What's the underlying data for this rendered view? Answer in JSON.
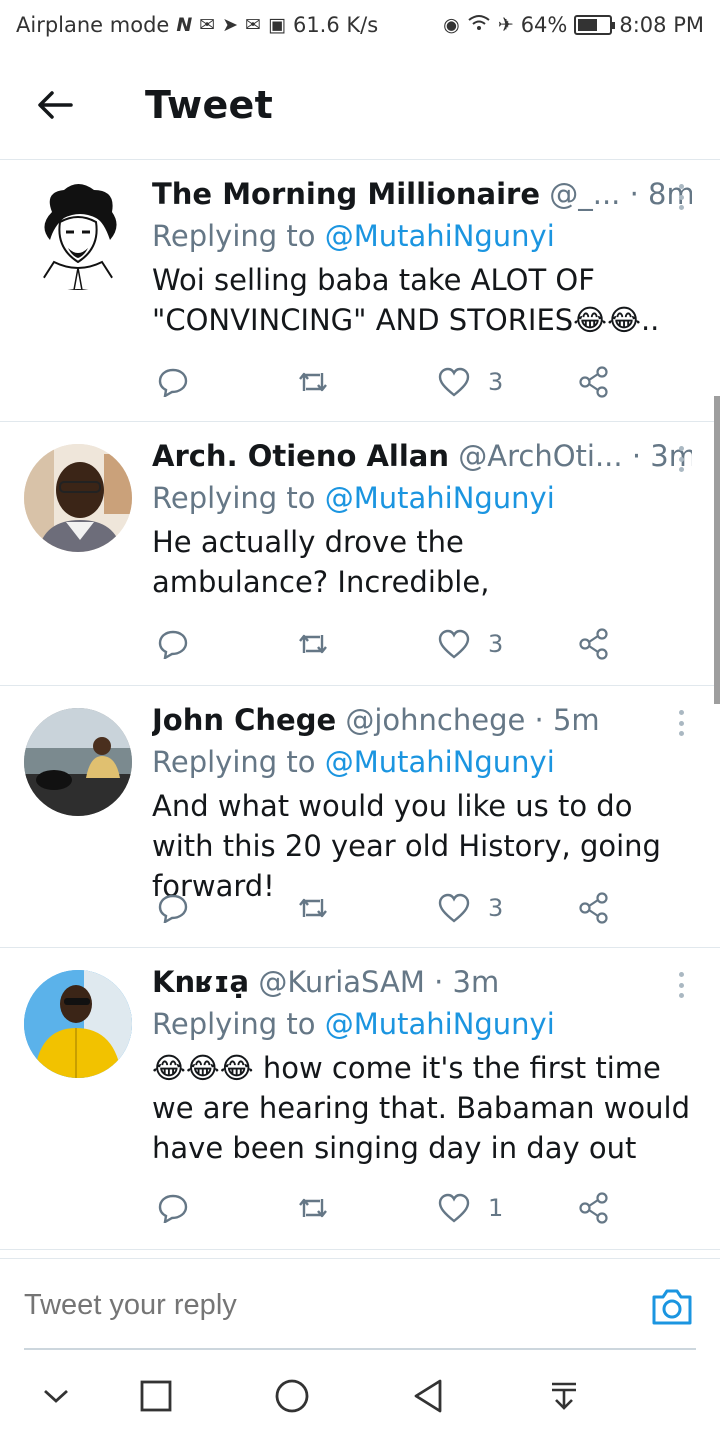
{
  "status_bar": {
    "left_text": "Airplane mode",
    "left_icons": [
      "nfc-icon",
      "mail-icon",
      "telegram-icon",
      "mail-icon",
      "app-icon"
    ],
    "speed": "61.6 K/s",
    "battery_text": "64%",
    "battery_level": 0.64,
    "time": "8:08 PM"
  },
  "header": {
    "title": "Tweet"
  },
  "tweets": [
    {
      "name": "The Morning Millionaire",
      "handle": "@_...",
      "time": "· 8m",
      "replying_label": "Replying to ",
      "replying_to": "@MutahiNgunyi",
      "text": "Woi selling baba take ALOT OF \"CONVINCING\" AND STORIES😂😂..",
      "likes": "3"
    },
    {
      "name": "Arch. Otieno Allan",
      "handle": "@ArchOti...",
      "time": "· 3m",
      "replying_label": "Replying to ",
      "replying_to": "@MutahiNgunyi",
      "text": "He actually drove the ambulance? Incredible,",
      "likes": "3"
    },
    {
      "name": "John Chege",
      "handle": "@johnchege",
      "time": "· 5m",
      "replying_label": "Replying to ",
      "replying_to": "@MutahiNgunyi",
      "text": "And what would you like us to do with this 20 year old History, going forward!",
      "likes": "3"
    },
    {
      "name": "Knʁɪạ",
      "handle": "@KuriaSAM",
      "time": "· 3m",
      "replying_label": "Replying to ",
      "replying_to": "@MutahiNgunyi",
      "text": "😂😂😂 how come it's the first time we are hearing that. Babaman would have been singing day in day out",
      "likes": "1"
    }
  ],
  "reply": {
    "placeholder": "Tweet your reply"
  },
  "colors": {
    "link": "#1b95e0",
    "muted": "#657786",
    "text": "#14171a",
    "divider": "#e1e8ed"
  }
}
